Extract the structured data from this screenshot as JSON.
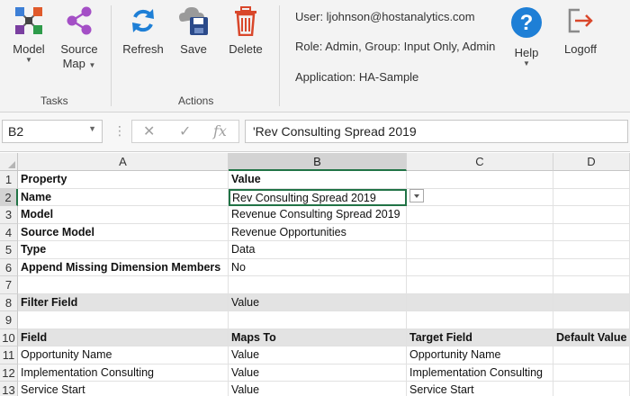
{
  "ribbon": {
    "tasks": {
      "label": "Tasks",
      "model": {
        "label": "Model",
        "icon": "network-nodes-icon"
      },
      "source_map": {
        "label_line1": "Source",
        "label_line2": "Map",
        "icon": "share-icon"
      }
    },
    "actions": {
      "label": "Actions",
      "refresh": {
        "label": "Refresh",
        "icon": "refresh-icon"
      },
      "save": {
        "label": "Save",
        "icon": "cloud-save-icon"
      },
      "delete": {
        "label": "Delete",
        "icon": "trash-icon"
      }
    },
    "session": {
      "user": "User: ljohnson@hostanalytics.com",
      "role": "Role: Admin, Group: Input Only, Admin",
      "application": "Application: HA-Sample"
    },
    "help": {
      "label": "Help",
      "icon": "help-icon"
    },
    "logoff": {
      "label": "Logoff",
      "icon": "logoff-icon"
    }
  },
  "formula_bar": {
    "name_box": "B2",
    "cancel_icon": "✕",
    "enter_icon": "✓",
    "function_icon": "fx",
    "value": "'Rev Consulting Spread 2019"
  },
  "sheet": {
    "active_cell": "B2",
    "columns": [
      "A",
      "B",
      "C",
      "D"
    ],
    "rows": [
      {
        "num": "1",
        "a": "Property",
        "b": "Value",
        "c": "",
        "d": ""
      },
      {
        "num": "2",
        "a": "Name",
        "b": "Rev Consulting Spread 2019",
        "c": "",
        "d": ""
      },
      {
        "num": "3",
        "a": "Model",
        "b": "Revenue Consulting Spread 2019",
        "c": "",
        "d": ""
      },
      {
        "num": "4",
        "a": "Source Model",
        "b": "Revenue Opportunities",
        "c": "",
        "d": ""
      },
      {
        "num": "5",
        "a": "Type",
        "b": "Data",
        "c": "",
        "d": ""
      },
      {
        "num": "6",
        "a": "Append Missing Dimension Members",
        "b": "No",
        "c": "",
        "d": ""
      },
      {
        "num": "7",
        "a": "",
        "b": "",
        "c": "",
        "d": ""
      },
      {
        "num": "8",
        "a": "Filter Field",
        "b": "Value",
        "c": "",
        "d": ""
      },
      {
        "num": "9",
        "a": "",
        "b": "",
        "c": "",
        "d": ""
      },
      {
        "num": "10",
        "a": "Field",
        "b": "Maps To",
        "c": "Target Field",
        "d": "Default Value"
      },
      {
        "num": "11",
        "a": "Opportunity Name",
        "b": "Value",
        "c": "Opportunity Name",
        "d": ""
      },
      {
        "num": "12",
        "a": "Implementation Consulting",
        "b": "Value",
        "c": "Implementation Consulting",
        "d": ""
      },
      {
        "num": "13",
        "a": "Service Start",
        "b": "Value",
        "c": "Service Start",
        "d": ""
      }
    ]
  },
  "colors": {
    "accent_blue": "#1e7fd6",
    "delete_red": "#d9472b",
    "logoff_red": "#d9472b",
    "excel_green": "#217346",
    "header_shade": "#e3e3e3"
  }
}
